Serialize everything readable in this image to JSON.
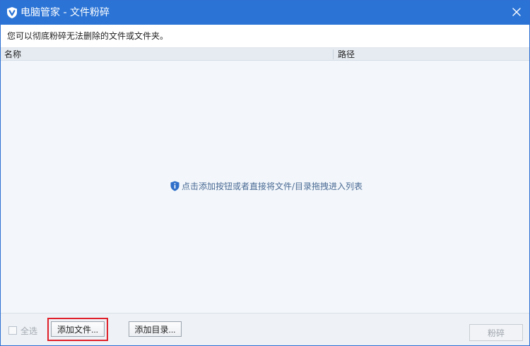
{
  "window": {
    "title": "电脑管家 - 文件粉碎",
    "accent_color": "#2b74d6",
    "title_icon": "shield-v-icon",
    "close_icon": "close-icon"
  },
  "description": "您可以彻底粉碎无法删除的文件或文件夹。",
  "list": {
    "columns": [
      "名称",
      "路径"
    ],
    "empty_hint": "点击添加按钮或者直接将文件/目录拖拽进入列表",
    "hint_icon": "info-shield-icon"
  },
  "footer": {
    "select_all_label": "全选",
    "select_all_checked": false,
    "add_file_label": "添加文件...",
    "add_dir_label": "添加目录...",
    "shred_label": "粉碎",
    "highlight_color": "#e0202a"
  }
}
